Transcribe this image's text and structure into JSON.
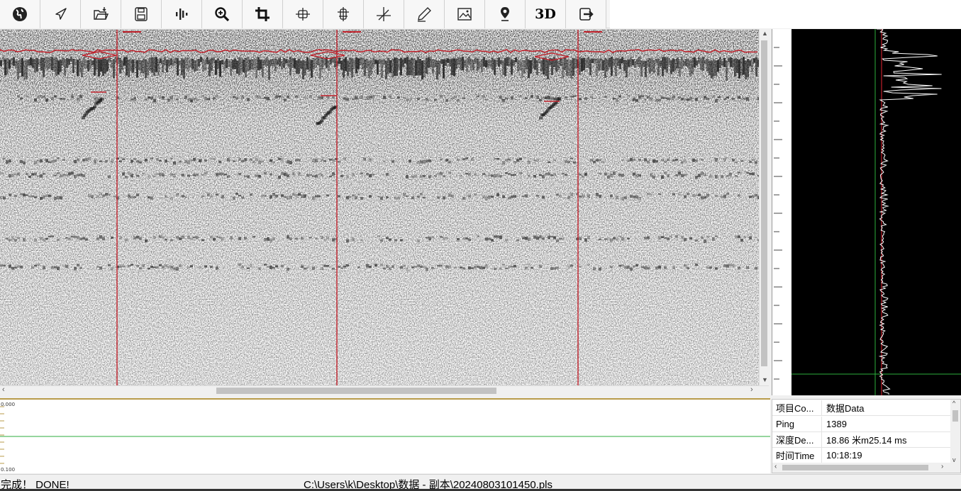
{
  "toolbar": {
    "buttons": [
      {
        "id": "globe",
        "icon": "globe-icon"
      },
      {
        "id": "navigate",
        "icon": "navigate-arrow-icon"
      },
      {
        "id": "open",
        "icon": "open-folder-icon"
      },
      {
        "id": "save",
        "icon": "save-disk-icon"
      },
      {
        "id": "signal",
        "icon": "signal-bars-icon"
      },
      {
        "id": "zoom",
        "icon": "zoom-in-icon"
      },
      {
        "id": "crop",
        "icon": "crop-icon"
      },
      {
        "id": "horizontal-marker",
        "icon": "horizontal-marker-icon"
      },
      {
        "id": "vertical-marker",
        "icon": "vertical-marker-icon"
      },
      {
        "id": "axis",
        "icon": "axis-cross-icon"
      },
      {
        "id": "draw",
        "icon": "pen-icon"
      },
      {
        "id": "image",
        "icon": "image-icon"
      },
      {
        "id": "location",
        "icon": "location-pin-icon"
      },
      {
        "id": "3d",
        "label": "3D"
      },
      {
        "id": "exit",
        "icon": "exit-arrow-icon"
      }
    ]
  },
  "bottom_graph": {
    "top_label": "0.000",
    "bottom_label": "0.100"
  },
  "properties": {
    "header_key": "项目Co...",
    "header_value": "数据Data",
    "rows": [
      {
        "key": "Ping",
        "value": "1389"
      },
      {
        "key": "深度De...",
        "value": "18.86 米m25.14 ms"
      },
      {
        "key": "时间Time",
        "value": "10:18:19"
      }
    ]
  },
  "status": {
    "message": "完成！ DONE!",
    "file_path": "C:\\Users\\k\\Desktop\\数据 - 副本\\20240803101450.pls"
  },
  "colors": {
    "marker_red": "#c0202a",
    "track_green": "#2cae3c",
    "axis_gold": "#b89b4a"
  }
}
